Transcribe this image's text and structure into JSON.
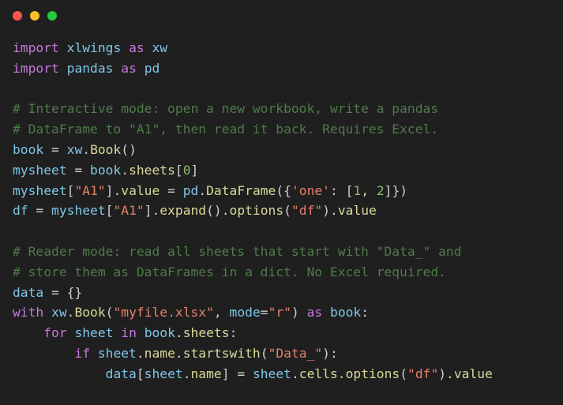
{
  "window": {
    "background_color": "#1f1f1f",
    "traffic_lights": [
      {
        "name": "close",
        "color": "#f8564f"
      },
      {
        "name": "minimize",
        "color": "#f9bd2e"
      },
      {
        "name": "maximize",
        "color": "#27c93f"
      }
    ]
  },
  "editor": {
    "language": "python",
    "theme_colors": {
      "background": "#1f1f1f",
      "keyword": "#c678dd",
      "variable": "#7fc6e8",
      "attribute": "#d8d89a",
      "string": "#e5806b",
      "number": "#89ba6a",
      "comment": "#4f7a4a",
      "punctuation": "#cfcfcf"
    },
    "lines": [
      {
        "id": "l1",
        "text": "import xlwings as xw"
      },
      {
        "id": "l2",
        "text": "import pandas as pd"
      },
      {
        "id": "l3",
        "text": ""
      },
      {
        "id": "l4",
        "text": "# Interactive mode: open a new workbook, write a pandas"
      },
      {
        "id": "l5",
        "text": "# DataFrame to \"A1\", then read it back. Requires Excel."
      },
      {
        "id": "l6",
        "text": "book = xw.Book()"
      },
      {
        "id": "l7",
        "text": "mysheet = book.sheets[0]"
      },
      {
        "id": "l8",
        "text": "mysheet[\"A1\"].value = pd.DataFrame({'one': [1, 2]})"
      },
      {
        "id": "l9",
        "text": "df = mysheet[\"A1\"].expand().options(\"df\").value"
      },
      {
        "id": "l10",
        "text": ""
      },
      {
        "id": "l11",
        "text": "# Reader mode: read all sheets that start with \"Data_\" and"
      },
      {
        "id": "l12",
        "text": "# store them as DataFrames in a dict. No Excel required."
      },
      {
        "id": "l13",
        "text": "data = {}"
      },
      {
        "id": "l14",
        "text": "with xw.Book(\"myfile.xlsx\", mode=\"r\") as book:"
      },
      {
        "id": "l15",
        "text": "    for sheet in book.sheets:"
      },
      {
        "id": "l16",
        "text": "        if sheet.name.startswith(\"Data_\"):"
      },
      {
        "id": "l17",
        "text": "            data[sheet.name] = sheet.cells.options(\"df\").value"
      }
    ],
    "tokens": [
      [
        [
          "kw",
          "import"
        ],
        [
          "plain",
          " "
        ],
        [
          "var",
          "xlwings"
        ],
        [
          "plain",
          " "
        ],
        [
          "kw",
          "as"
        ],
        [
          "plain",
          " "
        ],
        [
          "var",
          "xw"
        ]
      ],
      [
        [
          "kw",
          "import"
        ],
        [
          "plain",
          " "
        ],
        [
          "var",
          "pandas"
        ],
        [
          "plain",
          " "
        ],
        [
          "kw",
          "as"
        ],
        [
          "plain",
          " "
        ],
        [
          "var",
          "pd"
        ]
      ],
      [
        [
          "plain",
          ""
        ]
      ],
      [
        [
          "com",
          "# Interactive mode: open a new workbook, write a pandas"
        ]
      ],
      [
        [
          "com",
          "# DataFrame to \"A1\", then read it back. Requires Excel."
        ]
      ],
      [
        [
          "var",
          "book"
        ],
        [
          "punc",
          " = "
        ],
        [
          "var",
          "xw"
        ],
        [
          "punc",
          "."
        ],
        [
          "attr",
          "Book"
        ],
        [
          "punc",
          "()"
        ]
      ],
      [
        [
          "var",
          "mysheet"
        ],
        [
          "punc",
          " = "
        ],
        [
          "var",
          "book"
        ],
        [
          "punc",
          "."
        ],
        [
          "attr",
          "sheets"
        ],
        [
          "punc",
          "["
        ],
        [
          "num",
          "0"
        ],
        [
          "punc",
          "]"
        ]
      ],
      [
        [
          "var",
          "mysheet"
        ],
        [
          "punc",
          "["
        ],
        [
          "str",
          "\"A1\""
        ],
        [
          "punc",
          "]."
        ],
        [
          "attr",
          "value"
        ],
        [
          "punc",
          " = "
        ],
        [
          "var",
          "pd"
        ],
        [
          "punc",
          "."
        ],
        [
          "attr",
          "DataFrame"
        ],
        [
          "punc",
          "({"
        ],
        [
          "str",
          "'one'"
        ],
        [
          "punc",
          ": ["
        ],
        [
          "num",
          "1"
        ],
        [
          "punc",
          ", "
        ],
        [
          "num",
          "2"
        ],
        [
          "punc",
          "]})"
        ]
      ],
      [
        [
          "var",
          "df"
        ],
        [
          "punc",
          " = "
        ],
        [
          "var",
          "mysheet"
        ],
        [
          "punc",
          "["
        ],
        [
          "str",
          "\"A1\""
        ],
        [
          "punc",
          "]."
        ],
        [
          "attr",
          "expand"
        ],
        [
          "punc",
          "()."
        ],
        [
          "attr",
          "options"
        ],
        [
          "punc",
          "("
        ],
        [
          "str",
          "\"df\""
        ],
        [
          "punc",
          ")."
        ],
        [
          "attr",
          "value"
        ]
      ],
      [
        [
          "plain",
          ""
        ]
      ],
      [
        [
          "com",
          "# Reader mode: read all sheets that start with \"Data_\" and"
        ]
      ],
      [
        [
          "com",
          "# store them as DataFrames in a dict. No Excel required."
        ]
      ],
      [
        [
          "var",
          "data"
        ],
        [
          "punc",
          " = {}"
        ]
      ],
      [
        [
          "kw",
          "with"
        ],
        [
          "plain",
          " "
        ],
        [
          "var",
          "xw"
        ],
        [
          "punc",
          "."
        ],
        [
          "attr",
          "Book"
        ],
        [
          "punc",
          "("
        ],
        [
          "str",
          "\"myfile.xlsx\""
        ],
        [
          "punc",
          ", "
        ],
        [
          "var",
          "mode"
        ],
        [
          "punc",
          "="
        ],
        [
          "str",
          "\"r\""
        ],
        [
          "punc",
          ") "
        ],
        [
          "kw",
          "as"
        ],
        [
          "plain",
          " "
        ],
        [
          "var",
          "book"
        ],
        [
          "punc",
          ":"
        ]
      ],
      [
        [
          "plain",
          "    "
        ],
        [
          "kw",
          "for"
        ],
        [
          "plain",
          " "
        ],
        [
          "var",
          "sheet"
        ],
        [
          "plain",
          " "
        ],
        [
          "kw",
          "in"
        ],
        [
          "plain",
          " "
        ],
        [
          "var",
          "book"
        ],
        [
          "punc",
          "."
        ],
        [
          "attr",
          "sheets"
        ],
        [
          "punc",
          ":"
        ]
      ],
      [
        [
          "plain",
          "        "
        ],
        [
          "kw",
          "if"
        ],
        [
          "plain",
          " "
        ],
        [
          "var",
          "sheet"
        ],
        [
          "punc",
          "."
        ],
        [
          "attr",
          "name"
        ],
        [
          "punc",
          "."
        ],
        [
          "attr",
          "startswith"
        ],
        [
          "punc",
          "("
        ],
        [
          "str",
          "\"Data_\""
        ],
        [
          "punc",
          "):"
        ]
      ],
      [
        [
          "plain",
          "            "
        ],
        [
          "var",
          "data"
        ],
        [
          "punc",
          "["
        ],
        [
          "var",
          "sheet"
        ],
        [
          "punc",
          "."
        ],
        [
          "attr",
          "name"
        ],
        [
          "punc",
          "] = "
        ],
        [
          "var",
          "sheet"
        ],
        [
          "punc",
          "."
        ],
        [
          "attr",
          "cells"
        ],
        [
          "punc",
          "."
        ],
        [
          "attr",
          "options"
        ],
        [
          "punc",
          "("
        ],
        [
          "str",
          "\"df\""
        ],
        [
          "punc",
          ")."
        ],
        [
          "attr",
          "value"
        ]
      ]
    ]
  }
}
